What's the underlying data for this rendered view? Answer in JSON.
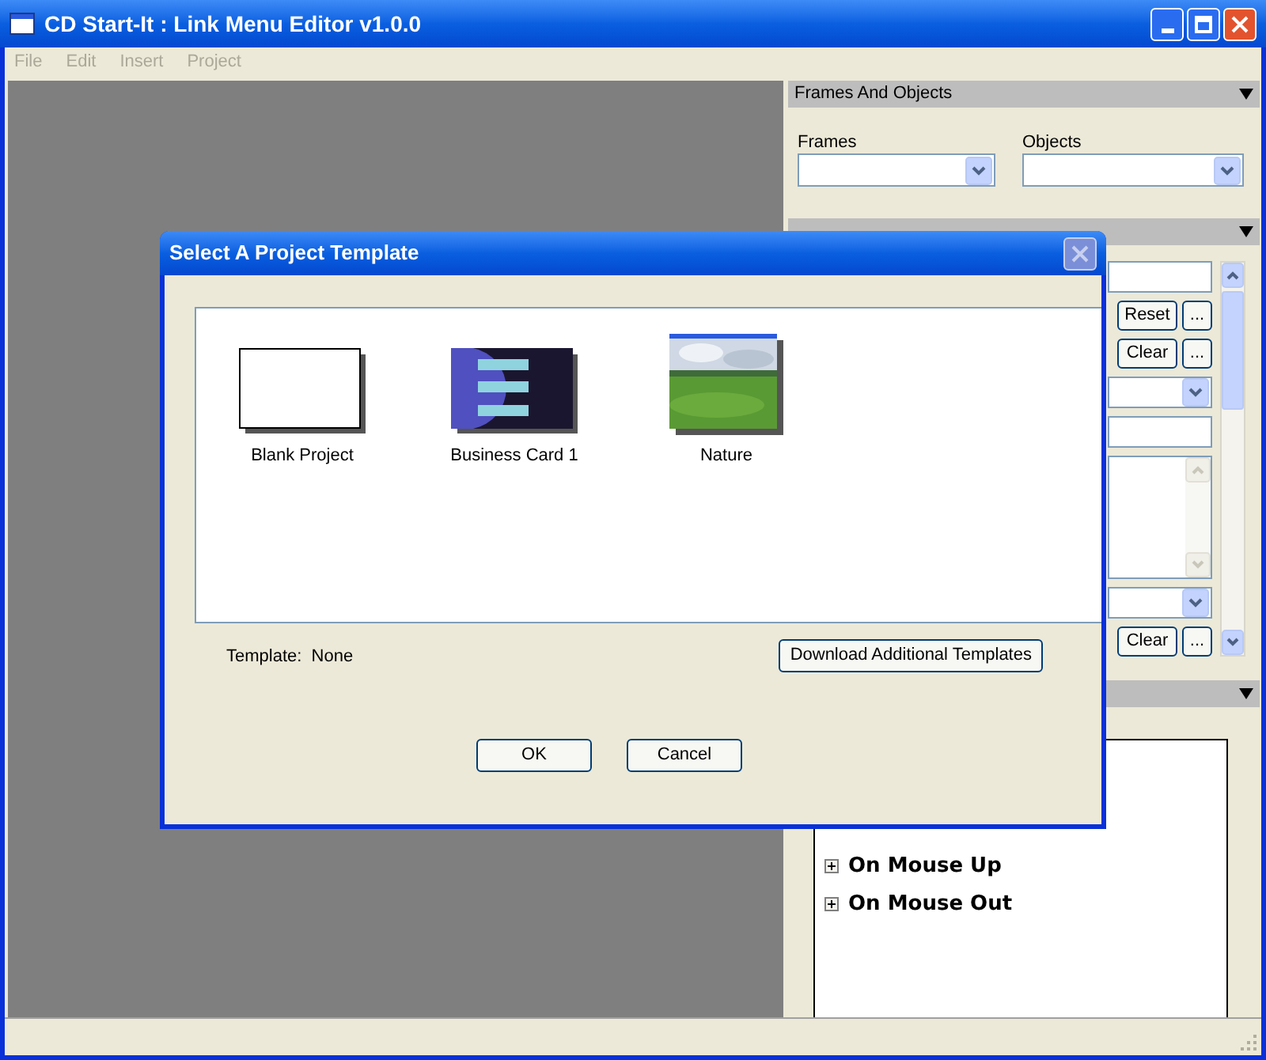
{
  "window": {
    "title": "CD Start-It : Link Menu Editor v1.0.0"
  },
  "menu": [
    {
      "label": "File",
      "disabled": true
    },
    {
      "label": "Edit",
      "disabled": true
    },
    {
      "label": "Insert",
      "disabled": true
    },
    {
      "label": "Project",
      "disabled": true
    }
  ],
  "frames_and_objects": {
    "title": "Frames And Objects",
    "fields": [
      {
        "label": "Frames"
      },
      {
        "label": "Objects"
      }
    ]
  },
  "object_properties": {
    "rows": [
      {
        "kind": "field"
      },
      {
        "kind": "buttons",
        "buttons": [
          "Reset",
          "..."
        ]
      },
      {
        "kind": "buttons",
        "buttons": [
          "Clear",
          "..."
        ]
      },
      {
        "kind": "combo"
      },
      {
        "kind": "field"
      },
      {
        "kind": "textarea"
      },
      {
        "kind": "combo"
      },
      {
        "kind": "buttons",
        "buttons": [
          "Clear",
          "..."
        ]
      }
    ]
  },
  "events": [
    {
      "label": "On Mouse Up",
      "expanded": false
    },
    {
      "label": "On Mouse Out",
      "expanded": false
    }
  ],
  "dialog": {
    "title": "Select A Project Template",
    "templates": [
      {
        "name": "Blank Project",
        "kind": "blank",
        "selected": false
      },
      {
        "name": "Business Card 1",
        "kind": "card",
        "selected": false
      },
      {
        "name": "Nature",
        "kind": "picture",
        "selected": false
      }
    ],
    "template_label": "Template:",
    "template_value": "None",
    "download_button": "Download Additional Templates",
    "buttons": [
      "OK",
      "Cancel"
    ]
  }
}
